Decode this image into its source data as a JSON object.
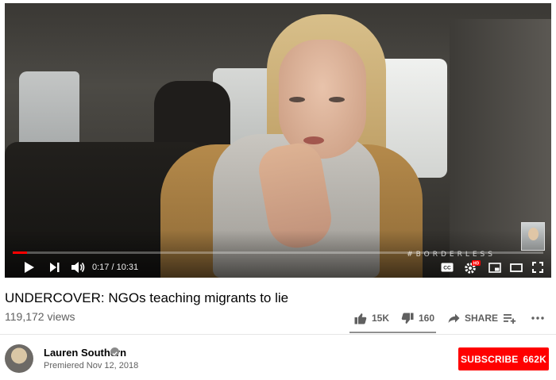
{
  "player": {
    "watermark": "#BORDERLESS",
    "time_current": "0:17",
    "time_separator": " / ",
    "time_total": "10:31",
    "progress_fraction": 0.027,
    "hd_badge": "HD",
    "cc_label": "CC"
  },
  "video": {
    "title": "UNDERCOVER: NGOs teaching migrants to lie",
    "views": "119,172 views"
  },
  "actions": {
    "likes": "15K",
    "dislikes": "160",
    "share_label": "SHARE"
  },
  "channel": {
    "name": "Lauren Southern",
    "published": "Premiered Nov 12, 2018"
  },
  "subscribe": {
    "label": "SUBSCRIBE",
    "count": "662K",
    "color": "#ff0000"
  },
  "colors": {
    "progress": "#ff0000",
    "text_secondary": "#606060"
  },
  "icons": [
    "play-icon",
    "next-icon",
    "volume-icon",
    "captions-icon",
    "settings-icon",
    "miniplayer-icon",
    "theater-icon",
    "fullscreen-icon",
    "thumbs-up-icon",
    "thumbs-down-icon",
    "share-icon",
    "add-to-playlist-icon",
    "more-icon",
    "verified-icon"
  ]
}
